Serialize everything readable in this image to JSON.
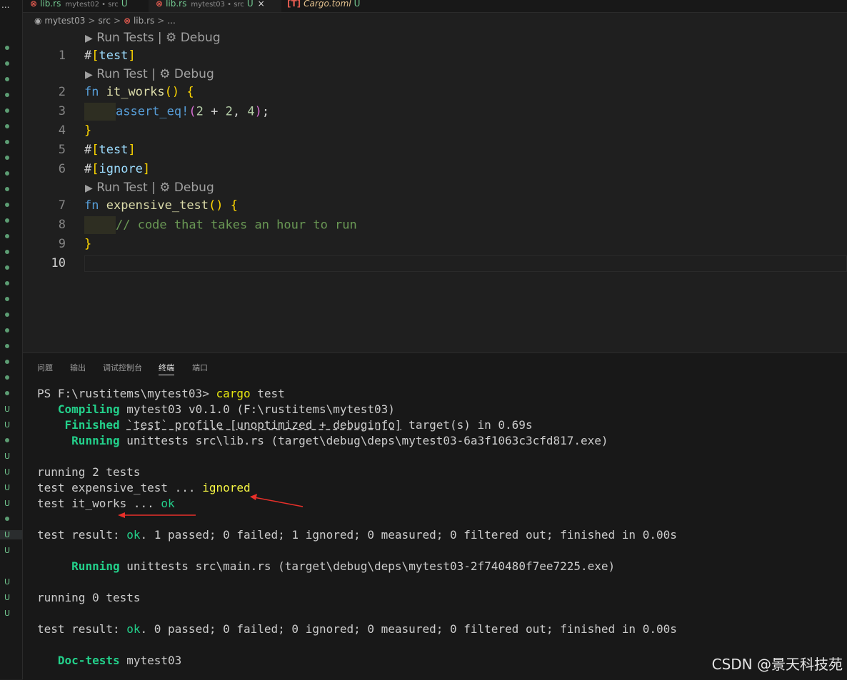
{
  "tabs": [
    {
      "name": "lib.rs",
      "desc": "mytest02 • src",
      "status": "U",
      "active": false
    },
    {
      "name": "lib.rs",
      "desc": "mytest03 • src",
      "status": "U",
      "active": true,
      "close": "×"
    },
    {
      "name": "Cargo.toml",
      "desc": "",
      "status": "U",
      "active": false
    }
  ],
  "overflow_menu": "...",
  "breadcrumb": {
    "project": "mytest03",
    "folder": "src",
    "file": "lib.rs",
    "trail": "..."
  },
  "codelens": {
    "tests": "Run Tests | ⚙ Debug",
    "test": "Run Test | ⚙ Debug"
  },
  "line_numbers": [
    "1",
    "2",
    "3",
    "4",
    "5",
    "6",
    "7",
    "8",
    "9",
    "10"
  ],
  "code": {
    "l1_hash": "#",
    "l1_open": "[",
    "l1_attr": "test",
    "l1_close": "]",
    "l2_kw": "fn",
    "l2_name": "it_works",
    "l2_paren": "()",
    "l2_brace": "{",
    "l3_macro": "assert_eq!",
    "l3_open": "(",
    "l3_a": "2",
    "l3_op": " + ",
    "l3_b": "2",
    "l3_comma": ", ",
    "l3_c": "4",
    "l3_close": ")",
    "l3_semi": ";",
    "l4_brace": "}",
    "l5_hash": "#",
    "l5_open": "[",
    "l5_attr": "test",
    "l5_close": "]",
    "l6_hash": "#",
    "l6_open": "[",
    "l6_attr": "ignore",
    "l6_close": "]",
    "l7_kw": "fn",
    "l7_name": "expensive_test",
    "l7_paren": "()",
    "l7_brace": "{",
    "l8_comment": "// code that takes an hour to run",
    "l9_brace": "}"
  },
  "panel_tabs": [
    "问题",
    "输出",
    "调试控制台",
    "终端",
    "端口"
  ],
  "terminal": {
    "prompt": "PS F:\\rustitems\\mytest03> ",
    "command": "cargo",
    "command_arg": " test",
    "compiling_label": "Compiling",
    "compiling_text": " mytest03 v0.1.0 (F:\\rustitems\\mytest03)",
    "finished_label": "Finished",
    "finished_pre": " ",
    "finished_profile": "`test` profile [unoptimized + debuginfo]",
    "finished_post": " target(s) in 0.69s",
    "running1_label": "Running",
    "running1_text": " unittests src\\lib.rs (target\\debug\\deps\\mytest03-6a3f1063c3cfd817.exe)",
    "running2tests": "running 2 tests",
    "test1_pre": "test expensive_test ... ",
    "test1_status": "ignored",
    "test2_pre": "test it_works ... ",
    "test2_status": "ok",
    "result1_pre": "test result: ",
    "result1_ok": "ok",
    "result1_post": ". 1 passed; 0 failed; 1 ignored; 0 measured; 0 filtered out; finished in 0.00s",
    "running2_label": "Running",
    "running2_text": " unittests src\\main.rs (target\\debug\\deps\\mytest03-2f740480f7ee7225.exe)",
    "running0tests": "running 0 tests",
    "result2_pre": "test result: ",
    "result2_ok": "ok",
    "result2_post": ". 0 passed; 0 failed; 0 ignored; 0 measured; 0 filtered out; finished in 0.00s",
    "doctests_label": "Doc-tests",
    "doctests_text": " mytest03"
  },
  "explorer_status": "U",
  "watermark": "CSDN @景天科技苑",
  "colors": {
    "git_untracked": "#73c991",
    "keyword": "#569cd6",
    "function": "#dcdcaa",
    "terminal_green": "#23d18b",
    "terminal_yellow": "#f5f543",
    "annotation_arrow": "#e8302a"
  }
}
